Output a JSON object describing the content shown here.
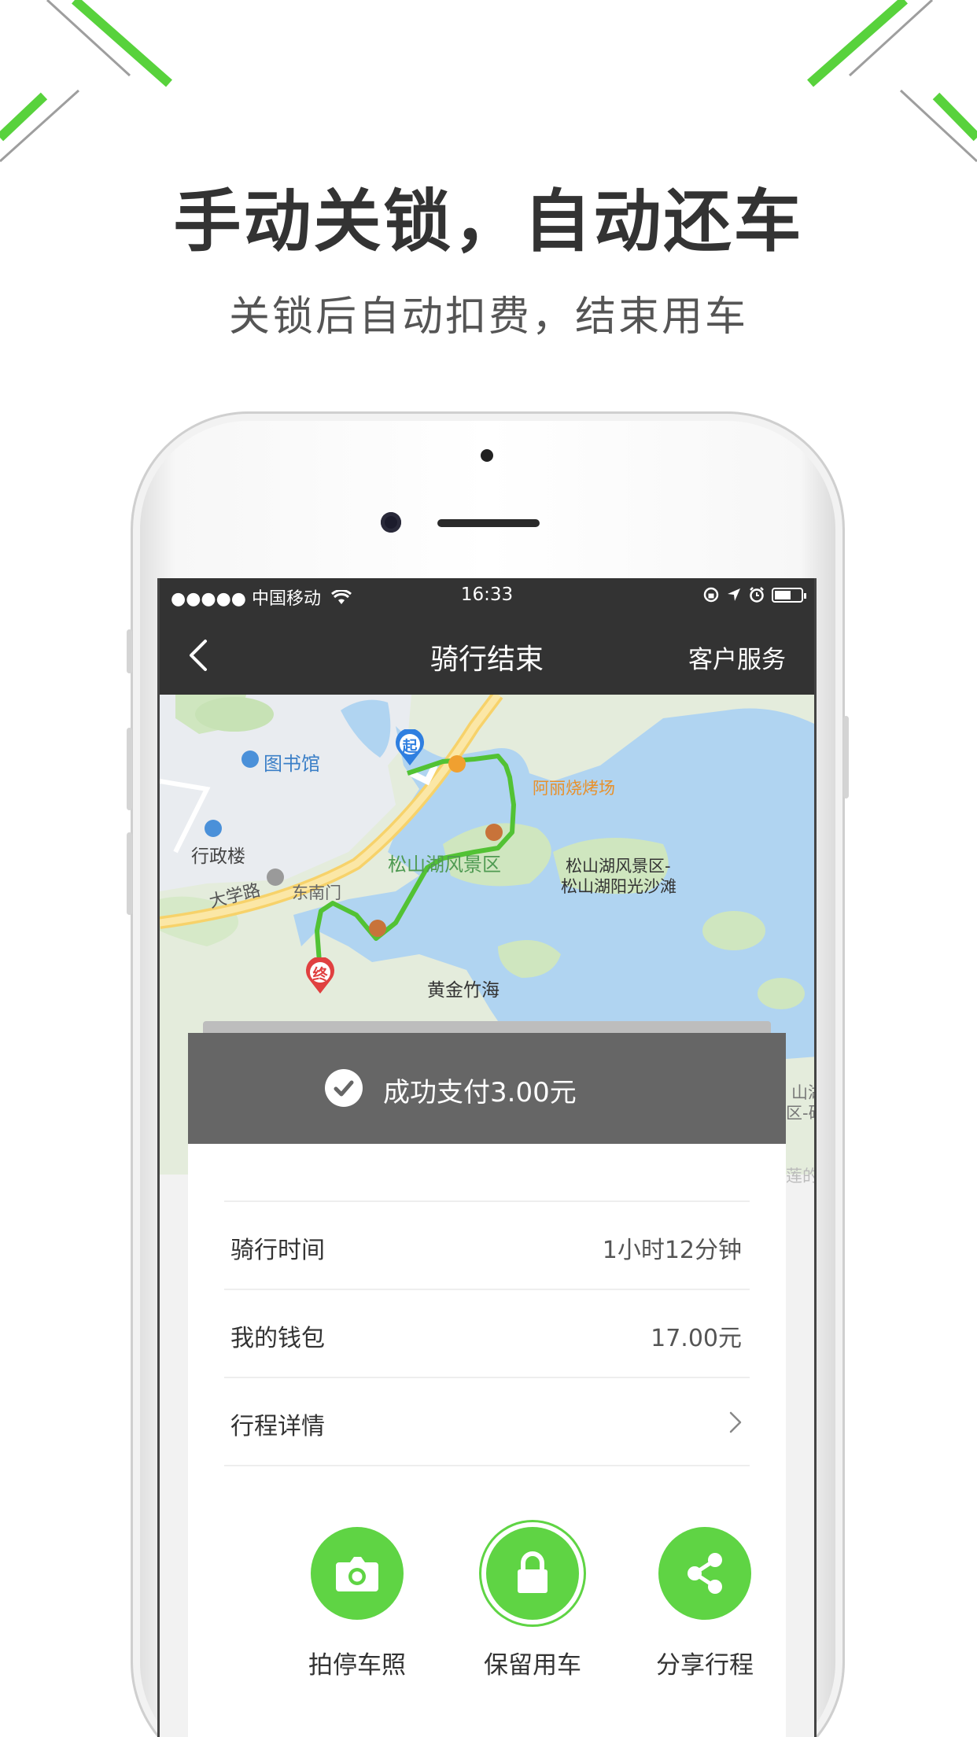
{
  "header": {
    "title": "手动关锁，自动还车",
    "subtitle": "关锁后自动扣费，结束用车"
  },
  "statusbar": {
    "carrier": "●●●●● 中国移动",
    "time": "16:33"
  },
  "navbar": {
    "title": "骑行结束",
    "right_label": "客户服务"
  },
  "map": {
    "labels": {
      "library": "图书馆",
      "admin": "行政楼",
      "road": "大学路",
      "east_gate": "东南门",
      "scenic": "松山湖风景区",
      "bbq": "阿丽烧烤场",
      "beach_1": "松山湖风景区-",
      "beach_2": "松山湖阳光沙滩",
      "bamboo": "黄金竹海",
      "start_marker": "起",
      "end_marker": "终",
      "edge_1": "山湖",
      "edge_2": "区-碌",
      "edge_3": "莲的"
    },
    "route_color": "#52c234"
  },
  "payment": {
    "message": "成功支付3.00元"
  },
  "details": [
    {
      "label": "骑行时间",
      "value": "1小时12分钟"
    },
    {
      "label": "我的钱包",
      "value": "17.00元"
    },
    {
      "label": "行程详情",
      "value": ""
    }
  ],
  "actions": [
    {
      "label": "拍停车照",
      "icon": "camera-icon"
    },
    {
      "label": "保留用车",
      "icon": "lock-icon"
    },
    {
      "label": "分享行程",
      "icon": "share-icon"
    }
  ],
  "colors": {
    "accent": "#5fd444",
    "dark_bar": "#333333",
    "banner": "#666666"
  }
}
